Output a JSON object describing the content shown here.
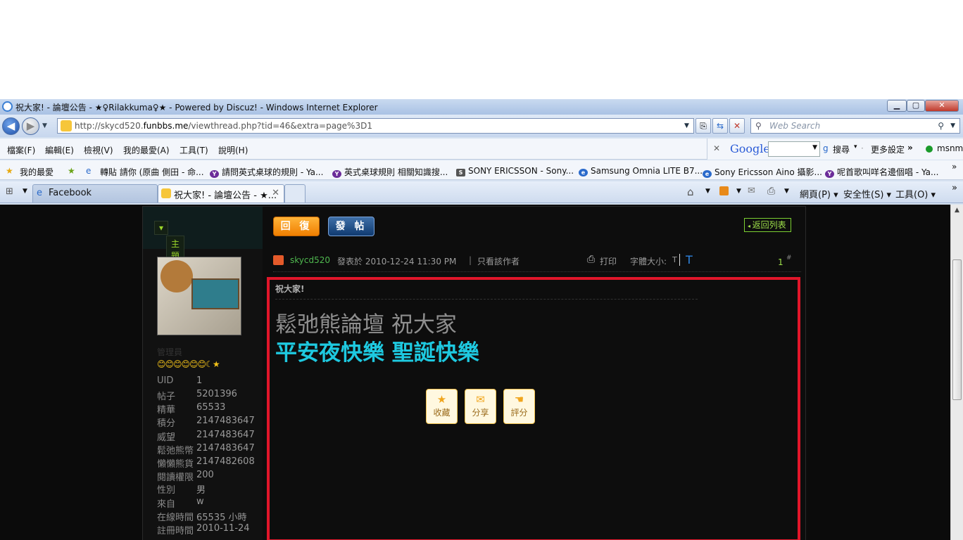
{
  "window": {
    "title": "祝大家! - 論壇公告 - ★♀Rilakkuma♀★ - Powered by Discuz! - Windows Internet Explorer"
  },
  "address": {
    "url_prefix": "http://skycd520.",
    "url_host": "funbbs.me",
    "url_rest": "/viewthread.php?tid=46&extra=page%3D1",
    "search_placeholder": "Web Search"
  },
  "menubar": {
    "items": [
      "檔案(F)",
      "編輯(E)",
      "檢視(V)",
      "我的最愛(A)",
      "工具(T)",
      "說明(H)"
    ],
    "google": {
      "logo": "Google",
      "search": "搜尋",
      "more": "更多設定",
      "msn": "msnm"
    }
  },
  "favorites": {
    "label": "我的最愛",
    "items": [
      "轉貼 請你 (原曲 側田 - 命...",
      "請問英式桌球的規則 - Ya...",
      "英式桌球規則 相關知識搜...",
      "SONY ERICSSON - Sony...",
      "Samsung Omnia LITE B7...",
      "Sony Ericsson Aino 攝影...",
      "呢首歌叫咩名邊個唱 - Ya..."
    ]
  },
  "tabs": {
    "items": [
      "Facebook",
      "祝大家! - 論壇公告 - ★..."
    ],
    "right": {
      "page": "網頁(P)",
      "safety": "安全性(S)",
      "tools": "工具(O)"
    }
  },
  "forum": {
    "topic_manage": "主題管理",
    "reply_label": "回 復",
    "newpost_label": "發 帖",
    "back_to_list": "返回列表",
    "author": "skycd520",
    "posted_at": "發表於 2010-12-24 11:30 PM",
    "only_author": "只看該作者",
    "print": "打印",
    "font_size": "字體大小:",
    "font_small": "T",
    "font_big": "T",
    "floor": "1",
    "floor_mark": "#",
    "post_title": "祝大家!",
    "line1": "鬆弛熊論壇 祝大家",
    "line2": "平安夜快樂 聖誕快樂",
    "actions": {
      "fav": "收藏",
      "share": "分享",
      "rate": "評分"
    },
    "user": {
      "rank": "管理員",
      "stats": [
        {
          "label": "UID",
          "value": "1"
        },
        {
          "label": "帖子",
          "value": "5201396"
        },
        {
          "label": "精華",
          "value": "65533"
        },
        {
          "label": "積分",
          "value": "2147483647"
        },
        {
          "label": "威望",
          "value": "2147483647"
        },
        {
          "label": "鬆弛熊幣",
          "value": "2147483647"
        },
        {
          "label": "懶懶熊貨",
          "value": "2147482608"
        },
        {
          "label": "閱讀權限",
          "value": "200"
        },
        {
          "label": "性別",
          "value": "男"
        },
        {
          "label": "來自",
          "value": "w"
        },
        {
          "label": "在線時間",
          "value": "65535 小時"
        },
        {
          "label": "註冊時間",
          "value": "2010-11-24"
        }
      ]
    }
  }
}
